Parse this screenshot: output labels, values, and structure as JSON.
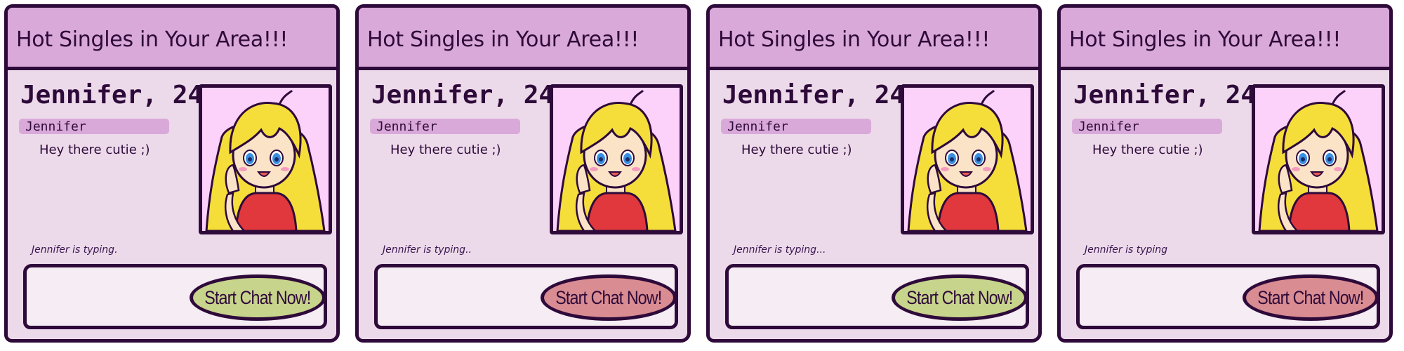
{
  "colors": {
    "outline": "#2e0a3a",
    "panel_bg": "#ecdaea",
    "header_bg": "#d9a9d9",
    "photo_bg": "#fcd2fa",
    "button_green": "#c7d48b",
    "button_red": "#d98c91"
  },
  "icons": {
    "profile_photo": "blonde-anime-girl-avatar"
  },
  "panels": [
    {
      "title": "Hot Singles in Your Area!!!",
      "profile_name": "Jennifer, 24",
      "sender": "Jennifer",
      "message": "Hey there cutie ;)",
      "typing_status": "Jennifer is typing.",
      "button_label": "Start Chat Now!",
      "button_color": "#c7d48b"
    },
    {
      "title": "Hot Singles in Your Area!!!",
      "profile_name": "Jennifer, 24",
      "sender": "Jennifer",
      "message": "Hey there cutie ;)",
      "typing_status": "Jennifer is typing..",
      "button_label": "Start Chat Now!",
      "button_color": "#d98c91"
    },
    {
      "title": "Hot Singles in Your Area!!!",
      "profile_name": "Jennifer, 24",
      "sender": "Jennifer",
      "message": "Hey there cutie ;)",
      "typing_status": "Jennifer is typing...",
      "button_label": "Start Chat Now!",
      "button_color": "#c7d48b"
    },
    {
      "title": "Hot Singles in Your Area!!!",
      "profile_name": "Jennifer, 24",
      "sender": "Jennifer",
      "message": "Hey there cutie ;)",
      "typing_status": "Jennifer is typing",
      "button_label": "Start Chat Now!",
      "button_color": "#d98c91"
    }
  ]
}
